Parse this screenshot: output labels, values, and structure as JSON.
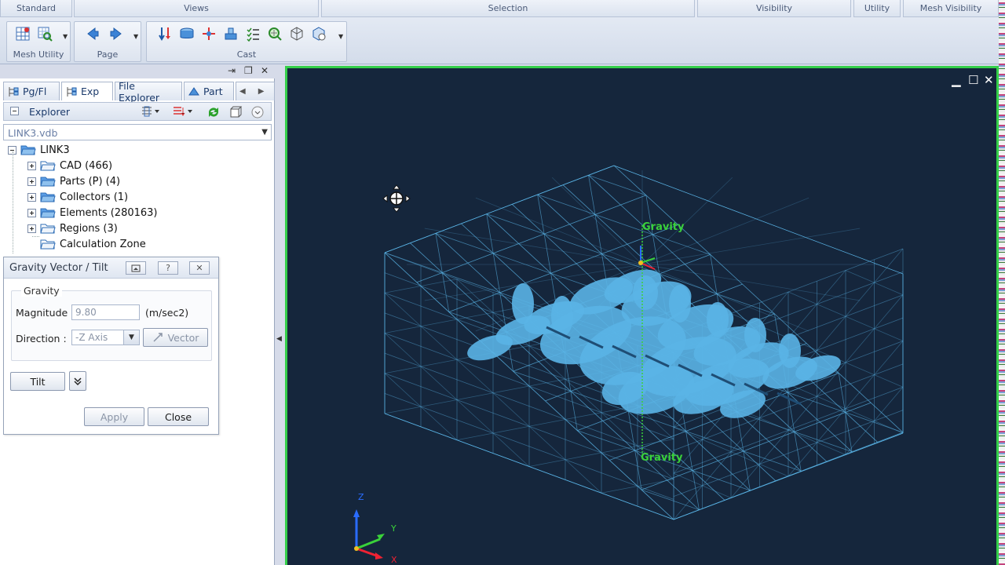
{
  "ribbon": {
    "top_groups": [
      {
        "label": "Standard"
      },
      {
        "label": "Views"
      },
      {
        "label": "Selection"
      },
      {
        "label": "Visibility"
      },
      {
        "label": "Utility"
      },
      {
        "label": "Mesh Visibility"
      }
    ],
    "groups": [
      {
        "label": "Mesh Utility"
      },
      {
        "label": "Page"
      },
      {
        "label": "Cast"
      }
    ]
  },
  "tabs": [
    {
      "label": "Pg/Fl"
    },
    {
      "label": "Exp"
    },
    {
      "label": "File Explorer"
    },
    {
      "label": "Part"
    }
  ],
  "explorer": {
    "title": "Explorer",
    "file": "LINK3.vdb"
  },
  "tree": [
    {
      "label": "LINK3"
    },
    {
      "label": "CAD (466)"
    },
    {
      "label": "Parts (P) (4)"
    },
    {
      "label": "Collectors (1)"
    },
    {
      "label": "Elements (280163)"
    },
    {
      "label": "Regions (3)"
    },
    {
      "label": "Calculation Zone"
    }
  ],
  "dialog": {
    "title": "Gravity Vector / Tilt",
    "group_label": "Gravity",
    "magnitude_label": "Magnitude :",
    "magnitude_value": "9.80",
    "magnitude_unit": "(m/sec2)",
    "direction_label": "Direction :",
    "direction_value": "-Z Axis",
    "vector_label": "Vector",
    "tilt_label": "Tilt",
    "apply_label": "Apply",
    "close_label": "Close"
  },
  "viewport": {
    "gravity_top_label": "Gravity",
    "gravity_bottom_label": "Gravity",
    "axis_z": "Z",
    "axis_y": "Y",
    "axis_x": "X"
  },
  "colors": {
    "viewport_bg": "#15263c",
    "viewport_border": "#35d04a",
    "mesh": "#5ab4e6",
    "gravity": "#3ad13a"
  }
}
